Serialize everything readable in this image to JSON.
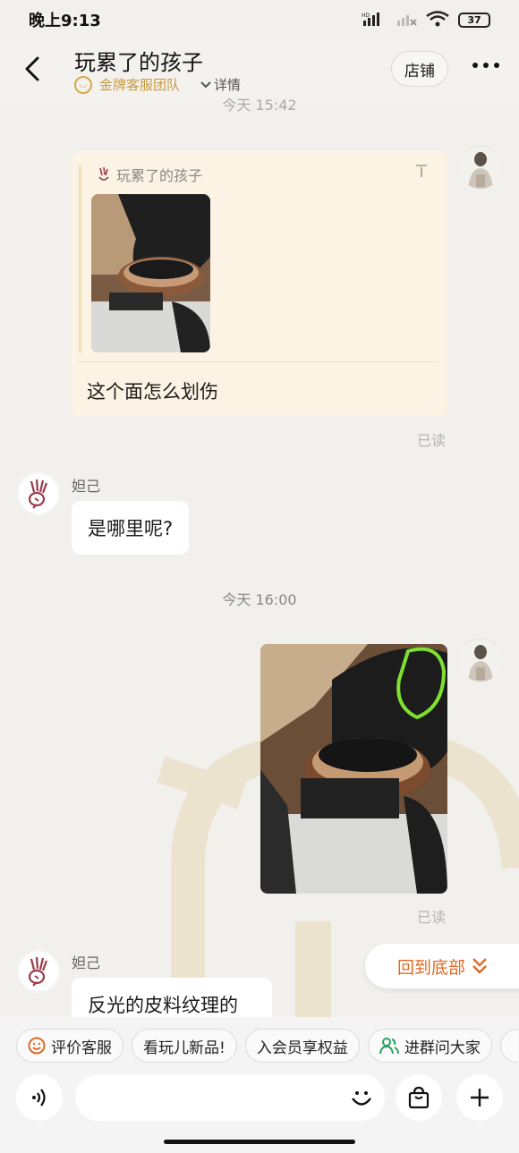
{
  "status_bar": {
    "time": "晚上9:13",
    "battery": "37",
    "network": "HD"
  },
  "header": {
    "title": "玩累了的孩子",
    "team_label": "金牌客服团队",
    "detail_label": "详情",
    "shop_label": "店铺"
  },
  "messages": {
    "ts1": "今天  15:42",
    "quote": {
      "name": "玩累了的孩子",
      "text": "这个面怎么划伤"
    },
    "read1": "已读",
    "agent_name1": "妲己",
    "agent_msg1": "是哪里呢?",
    "ts2": "今天  16:00",
    "read2": "已读",
    "agent_name2": "妲己",
    "agent_msg2": "反光的皮料纹理的"
  },
  "back_to_bottom": "回到底部",
  "quick_actions": [
    "评价客服",
    "看玩儿新品!",
    "入会员享权益",
    "进群问大家"
  ],
  "colors": {
    "accent": "#e06a24",
    "gold": "#c99a3e",
    "quote_bg": "#fdf3e4",
    "green_icon": "#2aa163"
  }
}
